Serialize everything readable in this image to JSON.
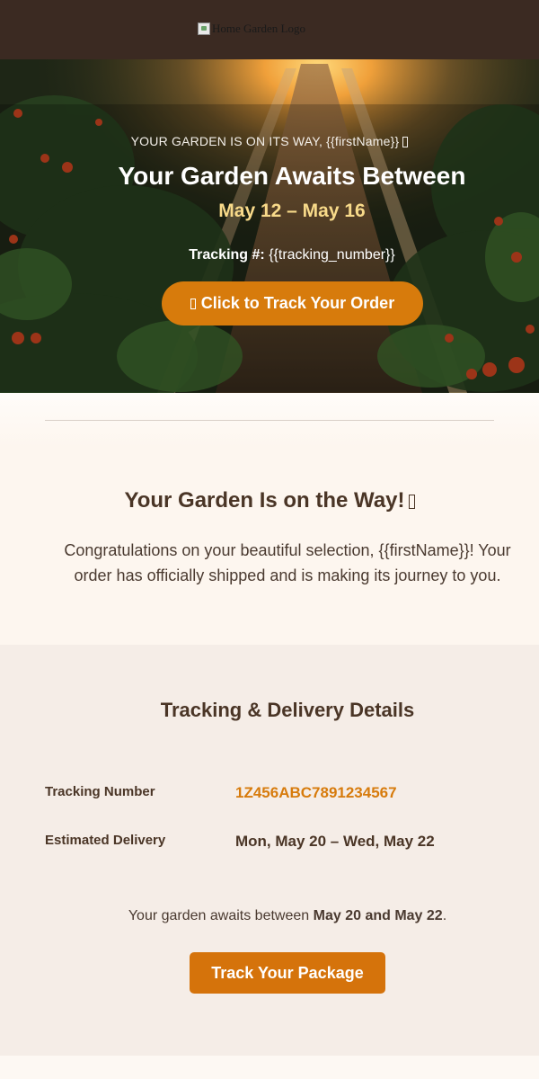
{
  "header": {
    "logo_alt": "Home Garden Logo"
  },
  "hero": {
    "eyebrow": "YOUR GARDEN IS ON ITS WAY, {{firstName}}",
    "title": "Your Garden Awaits Between",
    "dates": "May 12 – May 16",
    "tracking_label": "Tracking #:",
    "tracking_value": "{{tracking_number}}",
    "button_label": "Click to Track Your Order"
  },
  "intro": {
    "title": "Your Garden Is on the Way!",
    "body": "Congratulations on your beautiful selection, {{firstName}}! Your order has officially shipped and is making its journey to you."
  },
  "tracking": {
    "title": "Tracking & Delivery Details",
    "rows": [
      {
        "label": "Tracking Number",
        "value": "1Z456ABC7891234567"
      },
      {
        "label": "Estimated Delivery",
        "value": "Mon, May 20 – Wed, May 22"
      }
    ],
    "await_prefix": "Your garden awaits between",
    "await_dates": "May 20 and May 22",
    "await_suffix": ".",
    "button_label": "Track Your Package"
  },
  "colors": {
    "header_bg": "#3b2a22",
    "accent_orange": "#d77b0c",
    "date_yellow": "#f8da8a",
    "section_bg": "#f5ede7"
  }
}
